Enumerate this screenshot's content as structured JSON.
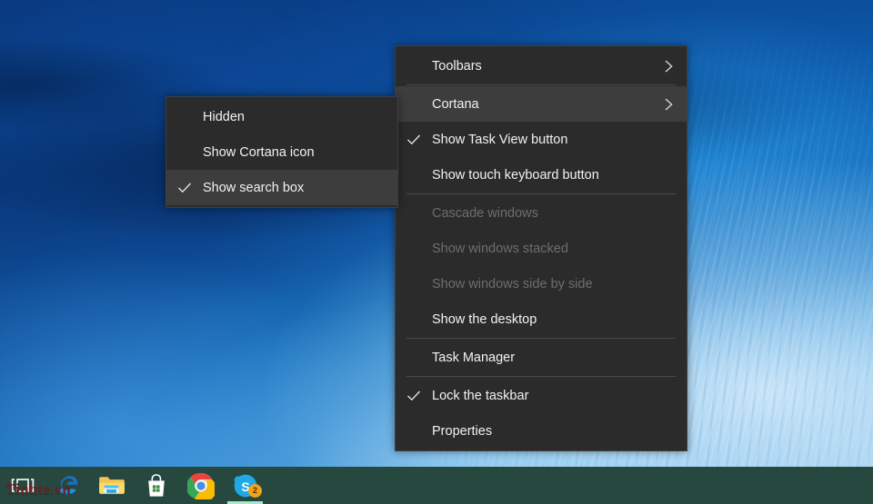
{
  "desktop": {
    "wallpaper_description": "blue ocean wave",
    "watermark": "Tinhte.vn",
    "colors": {
      "wallpaper_deep_blue": "#0a4790",
      "wallpaper_light_blue": "#cfe7f6",
      "taskbar": "#27483f",
      "menu_background": "#2b2b2b",
      "menu_highlight": "#3d3d3d",
      "menu_text": "#f2f2f2",
      "menu_text_disabled": "#6d6d6d",
      "menu_separator": "#4a4a4a",
      "badge": "#f0a31a",
      "taskbar_accent": "#a9e8c8",
      "watermark": "#6e1f24"
    }
  },
  "taskbar": {
    "items": [
      {
        "name": "task-view",
        "label": "Task View",
        "icon": "task-view-icon",
        "active": false,
        "badge": null
      },
      {
        "name": "edge",
        "label": "Microsoft Edge",
        "icon": "edge-icon",
        "active": false,
        "badge": null
      },
      {
        "name": "file-explorer",
        "label": "File Explorer",
        "icon": "folder-icon",
        "active": false,
        "badge": null
      },
      {
        "name": "store",
        "label": "Store",
        "icon": "store-bag-icon",
        "active": false,
        "badge": null
      },
      {
        "name": "chrome",
        "label": "Google Chrome",
        "icon": "chrome-icon",
        "active": false,
        "badge": null
      },
      {
        "name": "skype",
        "label": "Skype",
        "icon": "skype-icon",
        "active": true,
        "badge": "2"
      }
    ]
  },
  "context_menu": {
    "title": "Taskbar context menu",
    "items": [
      {
        "label": "Toolbars",
        "checked": false,
        "disabled": false,
        "highlighted": false,
        "submenu": true
      },
      {
        "separator": true
      },
      {
        "label": "Cortana",
        "checked": false,
        "disabled": false,
        "highlighted": true,
        "submenu": true
      },
      {
        "label": "Show Task View button",
        "checked": true,
        "disabled": false,
        "highlighted": false,
        "submenu": false
      },
      {
        "label": "Show touch keyboard button",
        "checked": false,
        "disabled": false,
        "highlighted": false,
        "submenu": false
      },
      {
        "separator": true
      },
      {
        "label": "Cascade windows",
        "checked": false,
        "disabled": true,
        "highlighted": false,
        "submenu": false
      },
      {
        "label": "Show windows stacked",
        "checked": false,
        "disabled": true,
        "highlighted": false,
        "submenu": false
      },
      {
        "label": "Show windows side by side",
        "checked": false,
        "disabled": true,
        "highlighted": false,
        "submenu": false
      },
      {
        "label": "Show the desktop",
        "checked": false,
        "disabled": false,
        "highlighted": false,
        "submenu": false
      },
      {
        "separator": true
      },
      {
        "label": "Task Manager",
        "checked": false,
        "disabled": false,
        "highlighted": false,
        "submenu": false
      },
      {
        "separator": true
      },
      {
        "label": "Lock the taskbar",
        "checked": true,
        "disabled": false,
        "highlighted": false,
        "submenu": false
      },
      {
        "label": "Properties",
        "checked": false,
        "disabled": false,
        "highlighted": false,
        "submenu": false
      }
    ]
  },
  "cortana_submenu": {
    "title": "Cortana submenu",
    "items": [
      {
        "label": "Hidden",
        "checked": false,
        "highlighted": false
      },
      {
        "label": "Show Cortana icon",
        "checked": false,
        "highlighted": false
      },
      {
        "label": "Show search box",
        "checked": true,
        "highlighted": true
      }
    ]
  },
  "glyphs": {
    "check": "✓",
    "chevron_right": "›"
  }
}
